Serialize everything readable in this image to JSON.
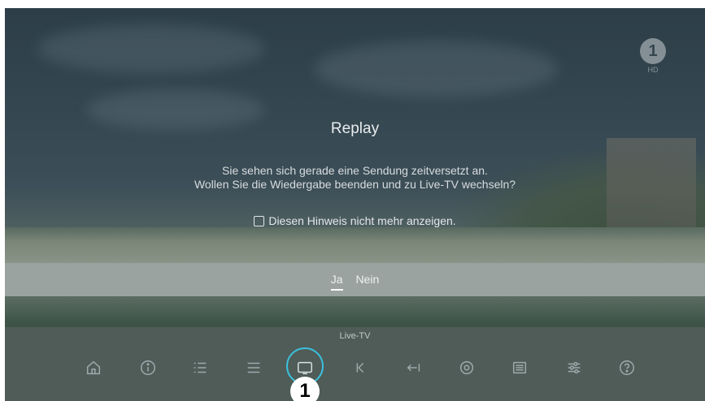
{
  "channel": {
    "logo_text": "1",
    "hd_label": "HD"
  },
  "dialog": {
    "title": "Replay",
    "message_line1": "Sie sehen sich gerade eine Sendung zeitversetzt an.",
    "message_line2": "Wollen Sie die Wiedergabe beenden und zu Live-TV wechseln?",
    "checkbox_label": "Diesen Hinweis nicht mehr anzeigen.",
    "checkbox_checked": false,
    "buttons": [
      {
        "label": "Ja",
        "selected": true
      },
      {
        "label": "Nein",
        "selected": false
      }
    ]
  },
  "menu": {
    "focused_label": "Live-TV",
    "icons": [
      "home-icon",
      "info-icon",
      "list-icon",
      "menu-icon",
      "live-tv-icon",
      "skip-back-icon",
      "back-to-start-icon",
      "record-icon",
      "guide-icon",
      "settings-icon",
      "help-icon"
    ]
  },
  "badge": {
    "text": "1"
  },
  "colors": {
    "focus_ring": "#3bbfdc",
    "button_bar": "#9aa3a0",
    "menu_bg": "#4f5c58"
  }
}
